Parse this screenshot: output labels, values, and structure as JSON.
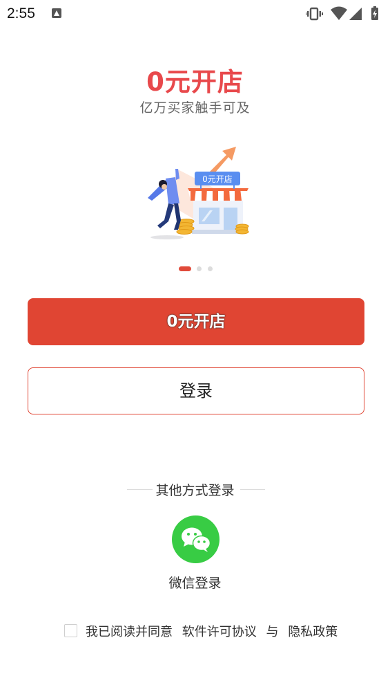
{
  "status_bar": {
    "time": "2:55",
    "notification_icon": "font-icon",
    "right_icons": [
      "vibrate-icon",
      "wifi-icon",
      "signal-icon",
      "battery-charging-icon"
    ]
  },
  "promo": {
    "headline": "0元开店",
    "subheadline": "亿万买家触手可及",
    "illustration_sign_text": "0元开店",
    "carousel": {
      "count": 3,
      "active_index": 0
    }
  },
  "actions": {
    "open_shop_label": "0元开店",
    "login_label": "登录"
  },
  "other_login": {
    "divider_label": "其他方式登录",
    "wechat_label": "微信登录",
    "wechat_icon": "wechat-icon"
  },
  "agreement": {
    "prefix": "我已阅读并同意",
    "license_link": "软件许可协议",
    "conjunction": "与",
    "privacy_link": "隐私政策"
  },
  "colors": {
    "accent_red": "#e04533",
    "headline_red": "#e8494c",
    "wechat_green": "#38cc44"
  }
}
